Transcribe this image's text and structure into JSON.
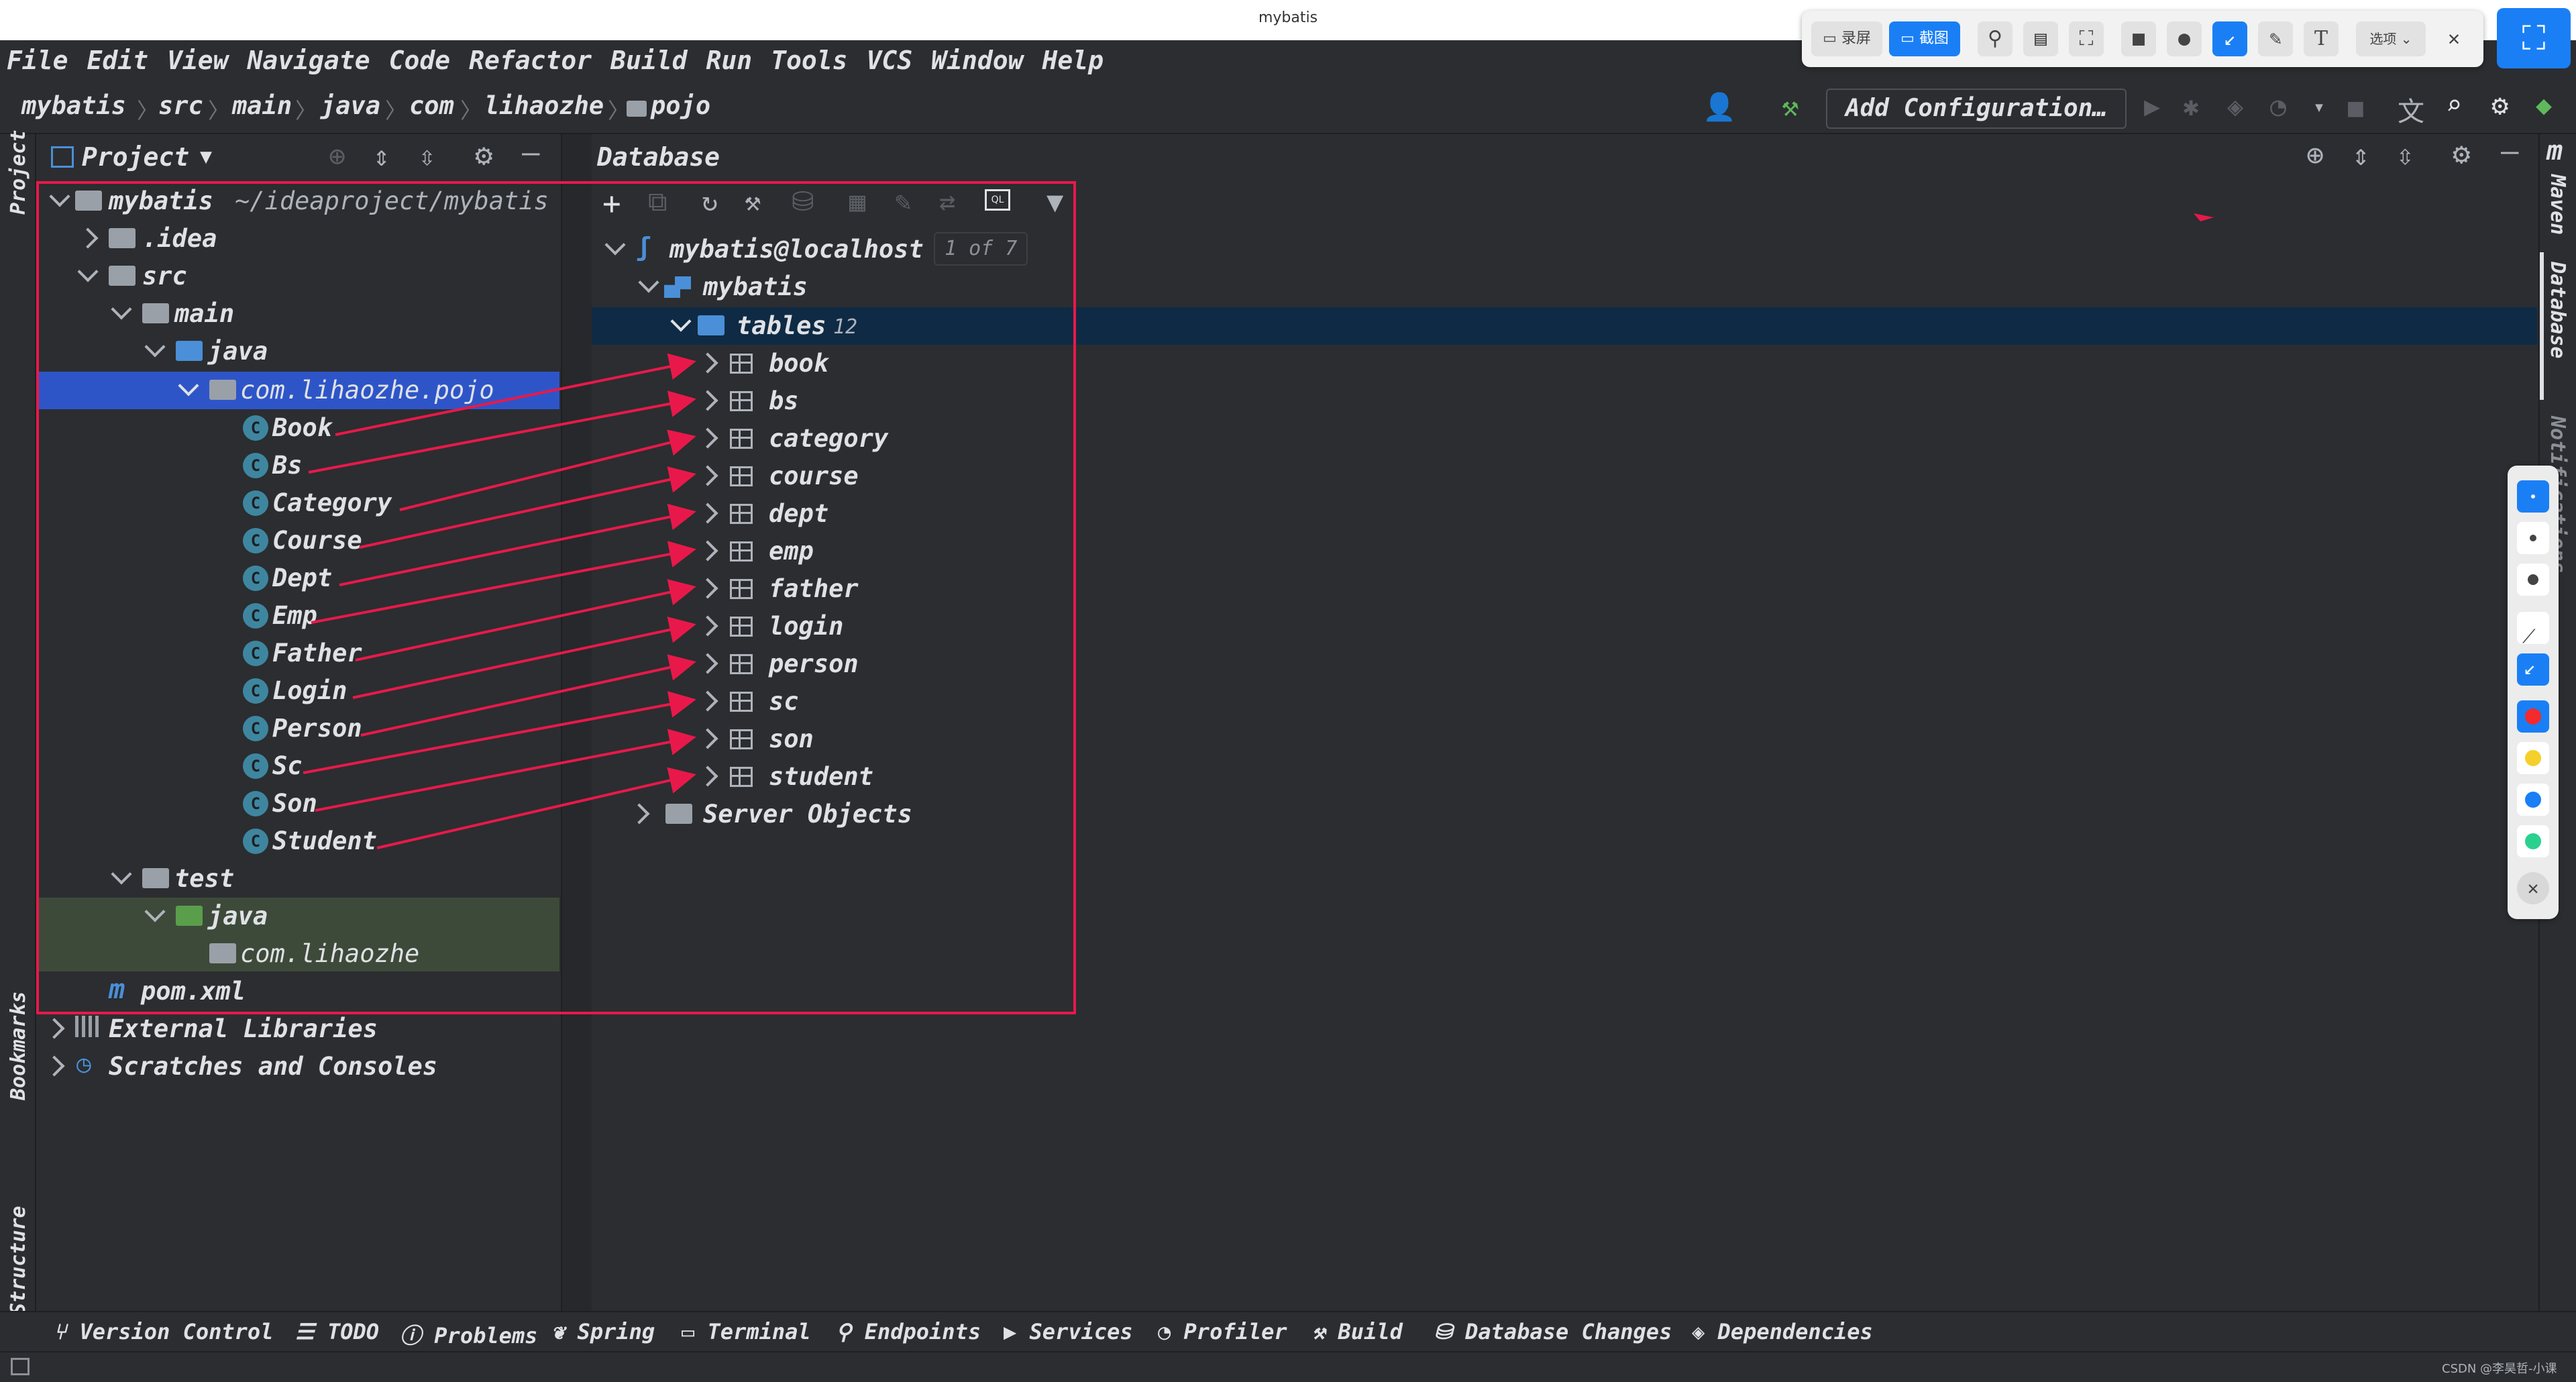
{
  "window": {
    "title": "mybatis"
  },
  "menu": [
    "File",
    "Edit",
    "View",
    "Navigate",
    "Code",
    "Refactor",
    "Build",
    "Run",
    "Tools",
    "VCS",
    "Window",
    "Help"
  ],
  "breadcrumb": [
    "mybatis",
    "src",
    "main",
    "java",
    "com",
    "lihaozhe",
    "pojo"
  ],
  "run_toolbar": {
    "add_configuration": "Add Configuration…"
  },
  "left_stripe": {
    "project": "Project",
    "bookmarks": "Bookmarks",
    "structure": "Structure"
  },
  "project_panel": {
    "title": "Project",
    "root": {
      "name": "mybatis",
      "path": "~/ideaproject/mybatis"
    },
    "idea": ".idea",
    "src": "src",
    "main": "main",
    "java": "java",
    "package": "com.lihaozhe.pojo",
    "classes": [
      "Book",
      "Bs",
      "Category",
      "Course",
      "Dept",
      "Emp",
      "Father",
      "Login",
      "Person",
      "Sc",
      "Son",
      "Student"
    ],
    "class_icon_letter": "C",
    "test": "test",
    "test_java": "java",
    "test_package": "com.lihaozhe",
    "pom": "pom.xml",
    "pom_icon_letter": "m",
    "external": "External Libraries",
    "scratches": "Scratches and Consoles"
  },
  "database_panel": {
    "title": "Database",
    "connection": "mybatis@localhost",
    "connection_badge": "1 of 7",
    "schema": "mybatis",
    "tables_label": "tables",
    "tables_count": "12",
    "tables": [
      "book",
      "bs",
      "category",
      "course",
      "dept",
      "emp",
      "father",
      "login",
      "person",
      "sc",
      "son",
      "student"
    ],
    "server_objects": "Server Objects"
  },
  "right_stripe": {
    "maven": "Maven",
    "database": "Database",
    "notifications": "Notifications"
  },
  "bottom_tabs": [
    "Version Control",
    "TODO",
    "Problems",
    "Spring",
    "Terminal",
    "Endpoints",
    "Services",
    "Profiler",
    "Build",
    "Database Changes",
    "Dependencies"
  ],
  "screenshot_tool": {
    "record": "录屏",
    "capture": "截图",
    "options": "选项"
  },
  "watermark": "CSDN @李昊哲-小课",
  "colors": {
    "background": "#2b2d30",
    "selection": "#2e55c8",
    "annotation": "#e8194a",
    "accent": "#1a7ff5"
  }
}
